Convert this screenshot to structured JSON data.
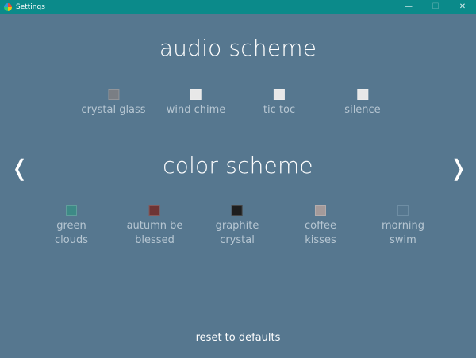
{
  "window": {
    "title": "Settings",
    "controls": {
      "minimize": "—",
      "maximize": "☐",
      "close": "✕"
    }
  },
  "audio": {
    "title": "audio scheme",
    "options": [
      {
        "label": "crystal glass",
        "selected": true,
        "color": "#7a7e84"
      },
      {
        "label": "wind chime",
        "selected": false,
        "color": "#e8e8e8"
      },
      {
        "label": "tic toc",
        "selected": false,
        "color": "#e8e8e8"
      },
      {
        "label": "silence",
        "selected": false,
        "color": "#e8e8e8"
      }
    ]
  },
  "color": {
    "title": "color scheme",
    "prev_arrow": "❬",
    "next_arrow": "❭",
    "options": [
      {
        "label_line1": "green",
        "label_line2": "clouds",
        "color": "#3d8a86"
      },
      {
        "label_line1": "autumn be",
        "label_line2": "blessed",
        "color": "#6e3434"
      },
      {
        "label_line1": "graphite",
        "label_line2": "crystal",
        "color": "#1e1e1e"
      },
      {
        "label_line1": "coffee",
        "label_line2": "kisses",
        "color": "#a49a9a"
      },
      {
        "label_line1": "morning",
        "label_line2": "swim",
        "color": "#56778f"
      }
    ]
  },
  "footer": {
    "reset_label": "reset to defaults"
  }
}
